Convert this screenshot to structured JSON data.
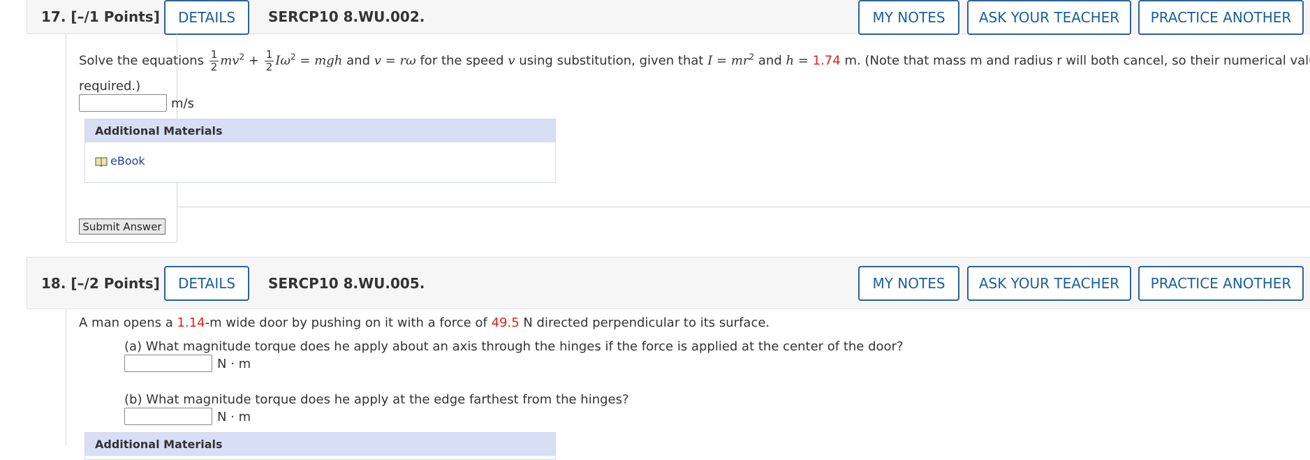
{
  "q17": {
    "number": "17.",
    "points": "[–/1 Points]",
    "details_label": "DETAILS",
    "id": "SERCP10 8.WU.002.",
    "my_notes_label": "MY NOTES",
    "ask_teacher_label": "ASK YOUR TEACHER",
    "practice_label": "PRACTICE ANOTHER",
    "text_solve": "Solve the equations",
    "frac_num": "1",
    "frac_den": "2",
    "text_m": "mv",
    "sup2": "2",
    "plus": "+",
    "text_I": "Iω",
    "eq": "= mgh",
    "and1": "and",
    "v_eq": "v = rω",
    "for_speed": "for the speed",
    "v_var": "v",
    "using": "using substitution, given that",
    "I_eq": "I = mr",
    "and2": "and",
    "h_eq": "h =",
    "h_value": "1.74",
    "note": "m. (Note that mass m and radius r will both cancel, so their numerical values aren't",
    "required": "required.)",
    "unit": "m/s",
    "additional_materials": "Additional Materials",
    "ebook": "eBook",
    "submit": "Submit Answer"
  },
  "q18": {
    "number": "18.",
    "points": "[–/2 Points]",
    "details_label": "DETAILS",
    "id": "SERCP10 8.WU.005.",
    "my_notes_label": "MY NOTES",
    "ask_teacher_label": "ASK YOUR TEACHER",
    "practice_label": "PRACTICE ANOTHER",
    "intro_a": "A man opens a",
    "width_value": "1.14",
    "intro_b": "-m wide door by pushing on it with a force of",
    "force_value": "49.5",
    "intro_c": "N directed perpendicular to its surface.",
    "part_a": "(a) What magnitude torque does he apply about an axis through the hinges if the force is applied at the center of the door?",
    "unit_a": "N · m",
    "part_b": "(b) What magnitude torque does he apply at the edge farthest from the hinges?",
    "unit_b": "N · m",
    "additional_materials": "Additional Materials"
  },
  "colors": {
    "accent": "#1a5f9e",
    "highlight": "#e0201c",
    "materials_header": "#d7def6"
  }
}
